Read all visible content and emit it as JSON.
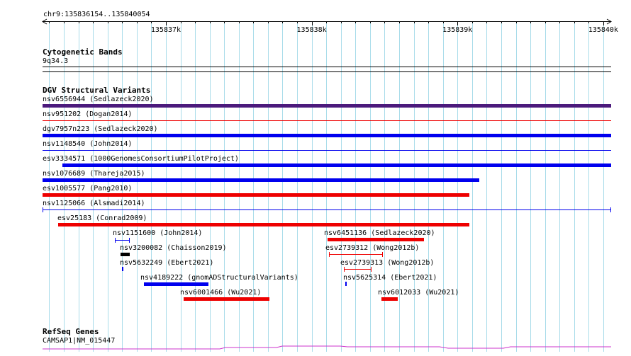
{
  "location": "chr9:135836154..135840054",
  "ruler": {
    "start": 135836154,
    "end": 135840054,
    "ticks": [
      {
        "value": 135837000,
        "label": "135837k"
      },
      {
        "value": 135838000,
        "label": "135838k"
      },
      {
        "value": 135839000,
        "label": "135839k"
      },
      {
        "value": 135840000,
        "label": "135840k"
      }
    ]
  },
  "tracks": {
    "cytoband": {
      "title": "Cytogenetic Bands",
      "band": "9q34.3"
    },
    "dgv": {
      "title": "DGV Structural Variants"
    },
    "refseq": {
      "title": "RefSeq Genes",
      "gene": "CAMSAP1|NM_015447"
    }
  },
  "colors": {
    "grid": "#a9dcea",
    "gain": "#0000ee",
    "loss": "#ee0000",
    "complex": "#4b1a7c",
    "inversion": "#000000",
    "gene": "#cc33cc"
  },
  "variants": [
    {
      "id": "nsv6556944",
      "source": "Sedlazeck2020",
      "label": "nsv6556944 (Sedlazeck2020)",
      "start": 135836154,
      "end": 135840054,
      "type": "complex",
      "style": "thick"
    },
    {
      "id": "nsv951202",
      "source": "Dogan2014",
      "label": "nsv951202 (Dogan2014)",
      "start": 135836154,
      "end": 135840054,
      "type": "loss",
      "style": "line"
    },
    {
      "id": "dgv7957n223",
      "source": "Sedlazeck2020",
      "label": "dgv7957n223 (Sedlazeck2020)",
      "start": 135836154,
      "end": 135840054,
      "type": "gain",
      "style": "thick"
    },
    {
      "id": "nsv1148540",
      "source": "John2014",
      "label": "nsv1148540 (John2014)",
      "start": 135836154,
      "end": 135840054,
      "type": "gain",
      "style": "line"
    },
    {
      "id": "esv3334571",
      "source": "1000GenomesConsortiumPilotProject",
      "label": "esv3334571 (1000GenomesConsortiumPilotProject)",
      "start": 135836290,
      "end": 135840054,
      "type": "gain",
      "style": "thick"
    },
    {
      "id": "nsv1076689",
      "source": "Thareja2015",
      "label": "nsv1076689 (Thareja2015)",
      "start": 135836154,
      "end": 135839150,
      "type": "gain",
      "style": "thick"
    },
    {
      "id": "esv1005577",
      "source": "Pang2010",
      "label": "esv1005577 (Pang2010)",
      "start": 135836154,
      "end": 135839080,
      "type": "loss",
      "style": "thick"
    },
    {
      "id": "nsv1125066",
      "source": "Alsmadi2014",
      "label": "nsv1125066 (Alsmadi2014)",
      "start": 135836154,
      "end": 135840054,
      "type": "gain",
      "style": "capped"
    },
    {
      "id": "esv25183",
      "source": "Conrad2009",
      "label": "esv25183 (Conrad2009)",
      "start": 135836260,
      "end": 135839080,
      "type": "loss",
      "style": "thick"
    },
    {
      "id": "nsv1151600",
      "source": "John2014",
      "label": "nsv1151600 (John2014)",
      "start": 135836650,
      "end": 135836750,
      "type": "gain",
      "style": "capped"
    },
    {
      "id": "nsv3200082",
      "source": "Chaisson2019",
      "label": "nsv3200082 (Chaisson2019)",
      "start": 135836690,
      "end": 135836750,
      "type": "inversion",
      "style": "thick"
    },
    {
      "id": "nsv5632249",
      "source": "Ebert2021",
      "label": "nsv5632249 (Ebert2021)",
      "start": 135836700,
      "end": 135836710,
      "type": "gain",
      "style": "tick"
    },
    {
      "id": "nsv4189222",
      "source": "gnomADStructuralVariants",
      "label": "nsv4189222 (gnomADStructuralVariants)",
      "start": 135836850,
      "end": 135837290,
      "type": "gain",
      "style": "thick"
    },
    {
      "id": "nsv6001466",
      "source": "Wu2021",
      "label": "nsv6001466 (Wu2021)",
      "start": 135837120,
      "end": 135837710,
      "type": "loss",
      "style": "thick"
    },
    {
      "id": "nsv6451136",
      "source": "Sedlazeck2020",
      "label": "nsv6451136 (Sedlazeck2020)",
      "start": 135838110,
      "end": 135838770,
      "type": "loss",
      "style": "thick"
    },
    {
      "id": "esv2739312",
      "source": "Wong2012b",
      "label": "esv2739312 (Wong2012b)",
      "start": 135838120,
      "end": 135838490,
      "type": "loss",
      "style": "capped"
    },
    {
      "id": "esv2739313",
      "source": "Wong2012b",
      "label": "esv2739313 (Wong2012b)",
      "start": 135838220,
      "end": 135838410,
      "type": "loss",
      "style": "capped"
    },
    {
      "id": "nsv5625314",
      "source": "Ebert2021",
      "label": "nsv5625314 (Ebert2021)",
      "start": 135838230,
      "end": 135838240,
      "type": "gain",
      "style": "tick"
    },
    {
      "id": "nsv6012033",
      "source": "Wu2021",
      "label": "nsv6012033 (Wu2021)",
      "start": 135838480,
      "end": 135838590,
      "type": "loss",
      "style": "thick"
    }
  ]
}
